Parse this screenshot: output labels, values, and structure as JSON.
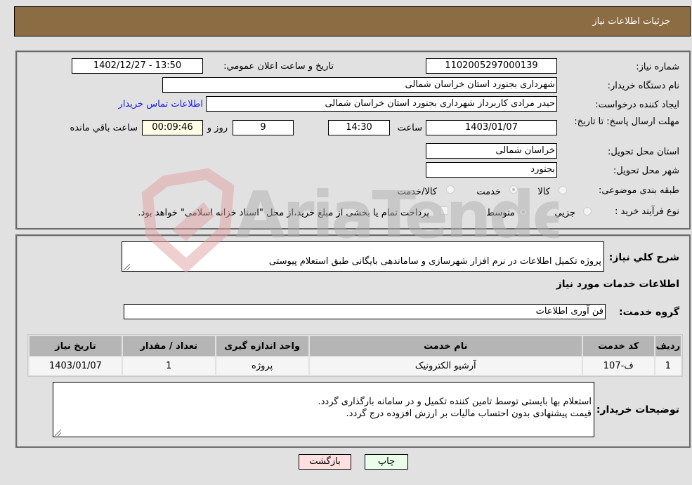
{
  "header": {
    "title": "جزئیات اطلاعات نیاز"
  },
  "form": {
    "need_number_label": "شماره نیاز:",
    "need_number": "1102005297000139",
    "announce_label": "تاریخ و ساعت اعلان عمومي:",
    "announce_value": "1402/12/27 - 13:50",
    "buyer_org_label": "نام دستگاه خریدار:",
    "buyer_org": "شهرداری بجنورد استان خراسان شمالی",
    "creator_label": "ایجاد کننده درخواست:",
    "creator": "حیدر مرادی کاربرداز  شهرداری بجنورد استان خراسان شمالی",
    "contact_link": "اطلاعات تماس خریدار",
    "deadline_label": "مهلت ارسال پاسخ: تا تاریخ:",
    "deadline_date": "1403/01/07",
    "time_label": "ساعت",
    "deadline_time": "14:30",
    "days_value": "9",
    "days_label": "روز و",
    "remaining_value": "00:09:46",
    "remaining_label": "ساعت باقي مانده",
    "province_label": "استان محل تحویل:",
    "province": "خراسان شمالی",
    "city_label": "شهر محل تحویل:",
    "city": "بجنورد",
    "category_label": "طبقه بندی موضوعی:",
    "category_options": [
      {
        "label": "کالا",
        "checked": false
      },
      {
        "label": "خدمت",
        "checked": true
      },
      {
        "label": "کالا/خدمت",
        "checked": false
      }
    ],
    "process_label": "نوع فرآیند خرید :",
    "process_options": [
      {
        "label": "جزيي",
        "checked": false
      },
      {
        "label": "متوسط",
        "checked": true
      }
    ],
    "treasury_note": "پرداخت تمام یا بخشی از مبلغ خرید،از محل \"اسناد خزانه اسلامی\" خواهد بود."
  },
  "details": {
    "description_label": "شرح کلي نیاز:",
    "description": "پروژه تکمیل اطلاعات در نرم افزار شهرسازی و ساماندهی بایگانی طبق استعلام پیوستی",
    "services_heading": "اطلاعات خدمات مورد نیاز",
    "service_group_label": "گروه خدمت:",
    "service_group": "فن آوری اطلاعات",
    "table": {
      "headers": [
        "ردیف",
        "کد خدمت",
        "نام خدمت",
        "واحد اندازه گیری",
        "تعداد / مقدار",
        "تاریخ نیاز"
      ],
      "rows": [
        [
          "1",
          "ف-107",
          "آرشیو الکترونیک",
          "پروژه",
          "1",
          "1403/01/07"
        ]
      ]
    },
    "buyer_notes_label": "توضیحات خریدار:",
    "buyer_notes": "استعلام بها بایستی توسط تامین کننده تکمیل و در سامانه بارگذاری گردد.\nقیمت پیشنهادی بدون احتساب مالیات بر ارزش افزوده درج گردد."
  },
  "buttons": {
    "print": "چاپ",
    "back": "بازگشت"
  },
  "watermark": {
    "text": "AriaTender.neT"
  },
  "colors": {
    "header_bg": "#8c6c42",
    "print_bg": "#eaffea",
    "back_bg": "#ffe0e0",
    "timer_bg": "#ffffe6",
    "link": "#1a1aee"
  }
}
